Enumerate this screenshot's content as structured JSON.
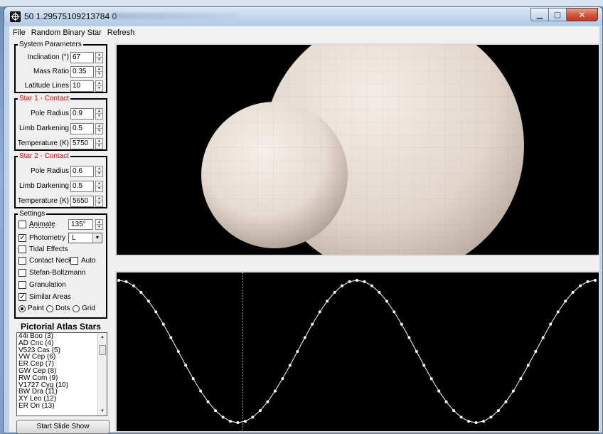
{
  "window": {
    "title": "50 1.29575109213784 0"
  },
  "menu": {
    "file": "File",
    "random": "Random Binary Star",
    "refresh": "Refresh"
  },
  "system_parameters": {
    "title": "System Parameters",
    "inclination_label": "Inclination (°)",
    "inclination_value": "67",
    "mass_ratio_label": "Mass Ratio",
    "mass_ratio_value": "0.35",
    "latitude_lines_label": "Latitude Lines",
    "latitude_lines_value": "10"
  },
  "star1": {
    "title": "Star 1 - Contact",
    "pole_radius_label": "Pole Radius",
    "pole_radius_value": "0.9",
    "limb_darkening_label": "Limb Darkening",
    "limb_darkening_value": "0.5",
    "temperature_label": "Temperature (K)",
    "temperature_value": "5750"
  },
  "star2": {
    "title": "Star 2 - Contact",
    "pole_radius_label": "Pole Radius",
    "pole_radius_value": "0.6",
    "limb_darkening_label": "Limb Darkening",
    "limb_darkening_value": "0.5",
    "temperature_label": "Temperature (K)",
    "temperature_value": "5650"
  },
  "settings": {
    "title": "Settings",
    "animate_label": "Animate",
    "animate_checked": false,
    "phase_value": "135°",
    "photometry_label": "Photometry",
    "photometry_checked": true,
    "photometry_band": "L",
    "tidal_label": "Tidal Effects",
    "tidal_checked": false,
    "contact_neck_label": "Contact Neck",
    "contact_neck_checked": false,
    "auto_label": "Auto",
    "auto_checked": false,
    "stefan_label": "Stefan-Boltzmann",
    "stefan_checked": false,
    "granulation_label": "Granulation",
    "granulation_checked": false,
    "similar_label": "Similar Areas",
    "similar_checked": true,
    "render_modes": [
      "Paint",
      "Dots",
      "Grid"
    ],
    "render_selected": "Paint"
  },
  "atlas": {
    "title": "Pictorial Atlas Stars",
    "items": [
      "44i Boo (3)",
      "AD Cnc (4)",
      "V523 Cas (5)",
      "VW Cep (6)",
      "ER Cep (7)",
      "GW Cep (8)",
      "RW Com (9)",
      "V1727 Cyg (10)",
      "BW Dra (11)",
      "XY Leo (12)",
      "ER Ori (13)"
    ],
    "start_button": "Start Slide Show"
  },
  "colors": {
    "star_surface": "#e8dcd2",
    "plot_line": "#ffffff",
    "panel_background": "#000000",
    "title_red": "#e00000"
  },
  "light_curve": {
    "marker_phase": 0.26,
    "curve_peaks": [
      0.0,
      0.5,
      1.0
    ],
    "curve_minima": [
      0.25,
      0.75
    ]
  }
}
